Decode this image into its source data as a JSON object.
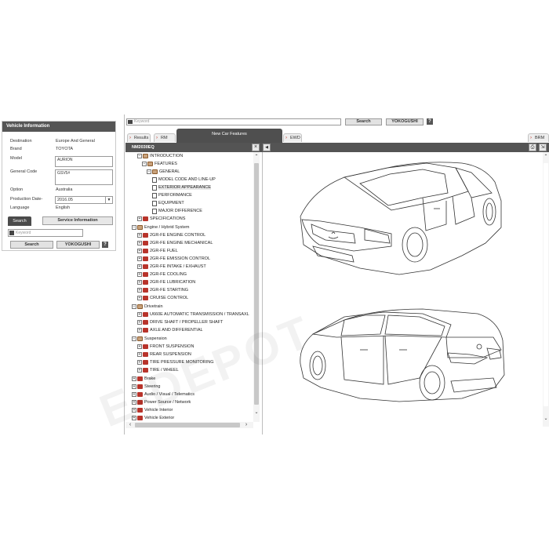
{
  "left_panel": {
    "title": "Vehicle Information",
    "rows": [
      {
        "label": "Destination",
        "value": "Europe And General"
      },
      {
        "label": "Brand",
        "value": "TOYOTA"
      },
      {
        "label": "Model",
        "value": "AURION"
      },
      {
        "label": "General Code",
        "value": "GSV5#"
      },
      {
        "label": "Option",
        "value": "Australia"
      },
      {
        "label": "Production Date-",
        "value": "2016.05"
      },
      {
        "label": "Language",
        "value": "English"
      }
    ],
    "search_tab": "Search",
    "service_info_button": "Service Information",
    "keyword_placeholder": "Keyword",
    "search_button": "Search",
    "yokogushi_button": "YOKOGUSHI",
    "help": "?"
  },
  "main": {
    "keyword_placeholder": "Keyword",
    "search_button": "Search",
    "yokogushi_button": "YOKOGUSHI",
    "help": "?",
    "tabs": [
      "Results",
      "RM",
      "New Car Features",
      "EWD",
      "BRM"
    ],
    "doc_title": "NM2030EQ",
    "tree": [
      {
        "label": "INTRODUCTION"
      },
      {
        "label": "FEATURES"
      },
      {
        "label": "GENERAL"
      },
      {
        "label": "MODEL CODE AND LINE-UP"
      },
      {
        "label": "EXTERIOR APPEARANCE"
      },
      {
        "label": "PERFORMANCE"
      },
      {
        "label": "EQUIPMENT"
      },
      {
        "label": "MAJOR DIFFERENCE"
      },
      {
        "label": "SPECIFICATIONS"
      },
      {
        "label": "Engine / Hybrid System"
      },
      {
        "label": "2GR-FE ENGINE CONTROL"
      },
      {
        "label": "2GR-FE ENGINE MECHANICAL"
      },
      {
        "label": "2GR-FE FUEL"
      },
      {
        "label": "2GR-FE EMISSION CONTROL"
      },
      {
        "label": "2GR-FE INTAKE / EXHAUST"
      },
      {
        "label": "2GR-FE COOLING"
      },
      {
        "label": "2GR-FE LUBRICATION"
      },
      {
        "label": "2GR-FE STARTING"
      },
      {
        "label": "CRUISE CONTROL"
      },
      {
        "label": "Drivetrain"
      },
      {
        "label": "U660E AUTOMATIC TRANSMISSION / TRANSAXL"
      },
      {
        "label": "DRIVE SHAFT / PROPELLER SHAFT"
      },
      {
        "label": "AXLE AND DIFFERENTIAL"
      },
      {
        "label": "Suspension"
      },
      {
        "label": "FRONT SUSPENSION"
      },
      {
        "label": "REAR SUSPENSION"
      },
      {
        "label": "TIRE PRESSURE MONITORING"
      },
      {
        "label": "TIRE / WHEEL"
      },
      {
        "label": "Brake"
      },
      {
        "label": "Steering"
      },
      {
        "label": "Audio / Visual / Telematics"
      },
      {
        "label": "Power Source / Network"
      },
      {
        "label": "Vehicle Interior"
      },
      {
        "label": "Vehicle Exterior"
      }
    ]
  },
  "watermark": "E-DEPOT"
}
